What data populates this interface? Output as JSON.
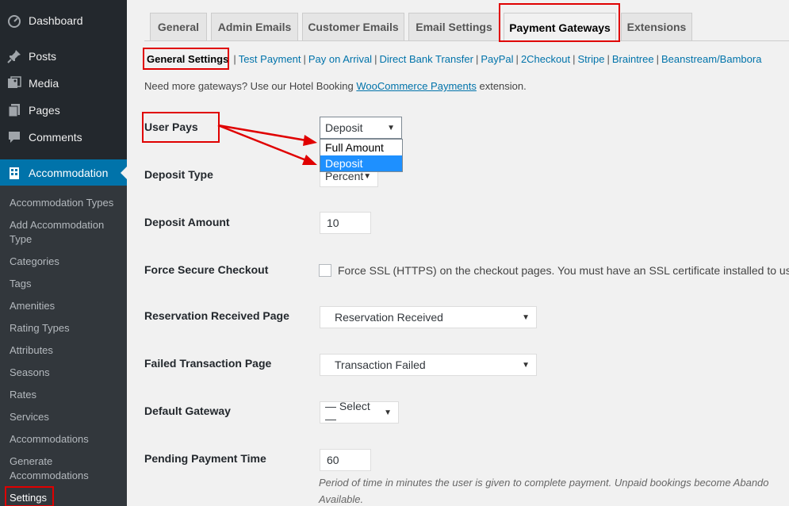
{
  "sidebar": {
    "top_items": [
      {
        "label": "Dashboard",
        "icon": "dashboard-icon"
      },
      {
        "label": "Posts",
        "icon": "pin-icon"
      },
      {
        "label": "Media",
        "icon": "media-icon"
      },
      {
        "label": "Pages",
        "icon": "pages-icon"
      },
      {
        "label": "Comments",
        "icon": "comments-icon"
      },
      {
        "label": "Accommodation",
        "icon": "building-icon"
      }
    ],
    "submenu": [
      "Accommodation Types",
      "Add Accommodation Type",
      "Categories",
      "Tags",
      "Amenities",
      "Rating Types",
      "Attributes",
      "Seasons",
      "Rates",
      "Services",
      "Accommodations",
      "Generate Accommodations",
      "Settings"
    ]
  },
  "tabs": [
    "General",
    "Admin Emails",
    "Customer Emails",
    "Email Settings",
    "Payment Gateways",
    "Extensions"
  ],
  "subnav": {
    "current": "General Settings",
    "links": [
      "Test Payment",
      "Pay on Arrival",
      "Direct Bank Transfer",
      "PayPal",
      "2Checkout",
      "Stripe",
      "Braintree",
      "Beanstream/Bambora"
    ]
  },
  "note": {
    "before": "Need more gateways? Use our Hotel Booking ",
    "link": "WooCommerce Payments",
    "after": " extension."
  },
  "form": {
    "user_pays": {
      "label": "User Pays",
      "value": "Deposit",
      "options": [
        "Full Amount",
        "Deposit"
      ]
    },
    "deposit_type": {
      "label": "Deposit Type",
      "value": "Percent"
    },
    "deposit_amount": {
      "label": "Deposit Amount",
      "value": "10"
    },
    "force_secure": {
      "label": "Force Secure Checkout",
      "checkbox_label": "Force SSL (HTTPS) on the checkout pages. You must have an SSL certificate installed to use th"
    },
    "reservation_page": {
      "label": "Reservation Received Page",
      "value": "Reservation Received"
    },
    "failed_page": {
      "label": "Failed Transaction Page",
      "value": "Transaction Failed"
    },
    "default_gateway": {
      "label": "Default Gateway",
      "value": "— Select —"
    },
    "pending_time": {
      "label": "Pending Payment Time",
      "value": "60",
      "desc_line1": "Period of time in minutes the user is given to complete payment. Unpaid bookings become Abando",
      "desc_line2": "Available."
    }
  },
  "caret": "▼",
  "annotation_color": "#e00000",
  "accent_color": "#0073aa"
}
